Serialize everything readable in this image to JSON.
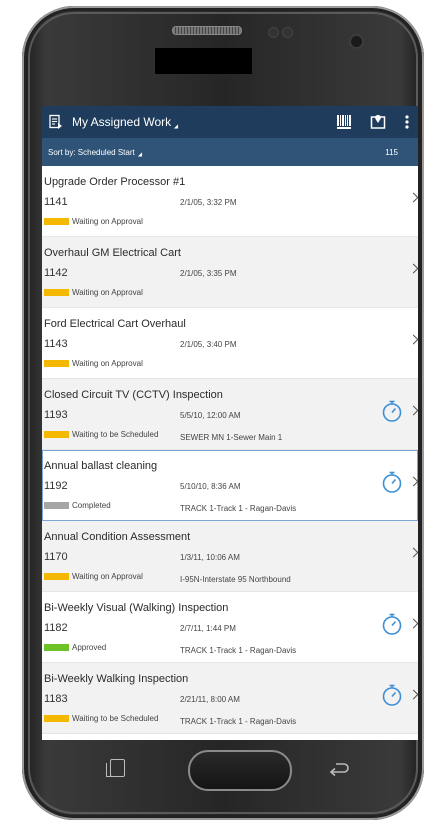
{
  "app": {
    "title": "My Assigned Work"
  },
  "sort": {
    "label": "Sort by: Scheduled Start",
    "count": "115"
  },
  "colors": {
    "appbar": "#1f3c5c",
    "sortbar": "#2f5478",
    "waiting": "#f5b800",
    "completed": "#a6a6a6",
    "approved": "#6cc227",
    "timer": "#3d8fd6"
  },
  "icons": {
    "title": "work-list-icon",
    "barcode": "barcode-icon",
    "map": "map-icon",
    "menu": "more-vertical-icon",
    "timer": "stopwatch-icon",
    "chevron": "chevron-right-icon"
  },
  "items": [
    {
      "title": "Upgrade Order Processor #1",
      "id": "1141",
      "date": "2/1/05, 3:32 PM",
      "location": "",
      "status": "Waiting on Approval",
      "status_color": "#f5b800",
      "timer": false,
      "bg": "white"
    },
    {
      "title": "Overhaul GM Electrical Cart",
      "id": "1142",
      "date": "2/1/05, 3:35 PM",
      "location": "",
      "status": "Waiting on Approval",
      "status_color": "#f5b800",
      "timer": false,
      "bg": "shade"
    },
    {
      "title": "Ford Electrical Cart Overhaul",
      "id": "1143",
      "date": "2/1/05, 3:40 PM",
      "location": "",
      "status": "Waiting on Approval",
      "status_color": "#f5b800",
      "timer": false,
      "bg": "white"
    },
    {
      "title": "Closed Circuit TV (CCTV) Inspection",
      "id": "1193",
      "date": "5/5/10, 12:00 AM",
      "location": "SEWER MN 1-Sewer Main 1",
      "status": "Waiting to be Scheduled",
      "status_color": "#f5b800",
      "timer": true,
      "bg": "shade"
    },
    {
      "title": "Annual ballast cleaning",
      "id": "1192",
      "date": "5/10/10, 8:36 AM",
      "location": "TRACK 1-Track 1 - Ragan-Davis",
      "status": "Completed",
      "status_color": "#a6a6a6",
      "timer": true,
      "bg": "selected"
    },
    {
      "title": "Annual Condition Assessment",
      "id": "1170",
      "date": "1/3/11, 10:06 AM",
      "location": "I-95N-Interstate 95 Northbound",
      "status": "Waiting on Approval",
      "status_color": "#f5b800",
      "timer": false,
      "bg": "shade"
    },
    {
      "title": "Bi-Weekly Visual (Walking) Inspection",
      "id": "1182",
      "date": "2/7/11, 1:44 PM",
      "location": "TRACK 1-Track 1 - Ragan-Davis",
      "status": "Approved",
      "status_color": "#6cc227",
      "timer": true,
      "bg": "white"
    },
    {
      "title": "Bi-Weekly Walking Inspection",
      "id": "1183",
      "date": "2/21/11, 8:00 AM",
      "location": "TRACK 1-Track 1 - Ragan-Davis",
      "status": "Waiting to be Scheduled",
      "status_color": "#f5b800",
      "timer": true,
      "bg": "shade"
    }
  ]
}
